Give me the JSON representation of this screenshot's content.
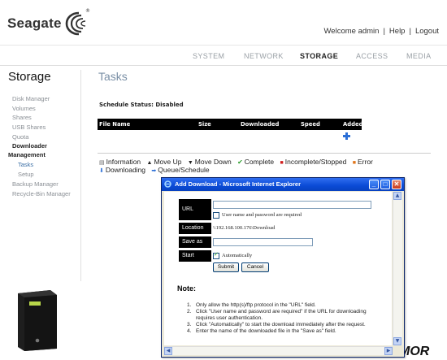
{
  "header": {
    "brand": "Seagate",
    "welcome": "Welcome admin",
    "help": "Help",
    "logout": "Logout"
  },
  "nav": {
    "items": [
      "SYSTEM",
      "NETWORK",
      "STORAGE",
      "ACCESS",
      "MEDIA"
    ],
    "active": "STORAGE"
  },
  "sidebar": {
    "title": "Storage",
    "items": [
      {
        "label": "Disk Manager"
      },
      {
        "label": "Volumes"
      },
      {
        "label": "Shares"
      },
      {
        "label": "USB Shares"
      },
      {
        "label": "Quota"
      },
      {
        "label": "Downloader"
      },
      {
        "label": "Management"
      },
      {
        "label": "Tasks"
      },
      {
        "label": "Setup"
      },
      {
        "label": "Backup Manager"
      },
      {
        "label": "Recycle-Bin Manager"
      }
    ]
  },
  "main": {
    "title": "Tasks",
    "schedule_status": "Schedule Status: Disabled",
    "table_headers": [
      "File Name",
      "Size",
      "Downloaded",
      "Speed",
      "Added"
    ],
    "legend_row1": [
      "Information",
      "Move Up",
      "Move Down",
      "Complete",
      "Incomplete/Stopped",
      "Error"
    ],
    "legend_row2": [
      "Downloading",
      "Queue/Schedule"
    ]
  },
  "watermark": "MOR",
  "dialog": {
    "title": "Add Download - Microsoft Internet Explorer",
    "labels": {
      "url": "URL",
      "location": "Location",
      "save_as": "Save as",
      "start": "Start"
    },
    "url_value": "",
    "save_as_value": "",
    "auth_checkbox_label": "User name and password are required",
    "location_value": "\\\\192.168.100.176\\Download",
    "automatically_label": "Automatically",
    "submit": "Submit",
    "cancel": "Cancel",
    "note_heading": "Note:",
    "notes": [
      "Only allow the http(s)/ftp protocol in the \"URL\" field.",
      "Click \"User name and password are required\" if the URL for downloading requires user authentication.",
      "Click \"Automatically\" to start the download immediately after the request.",
      "Enter the name of the downloaded file in the \"Save as\" field."
    ],
    "note_numbers": [
      "1.",
      "2.",
      "3.",
      "4."
    ]
  },
  "colors": {
    "accent": "#3a6ea5",
    "title_blue": "#7a8fa6",
    "xp_title": "#0a4ad6"
  }
}
